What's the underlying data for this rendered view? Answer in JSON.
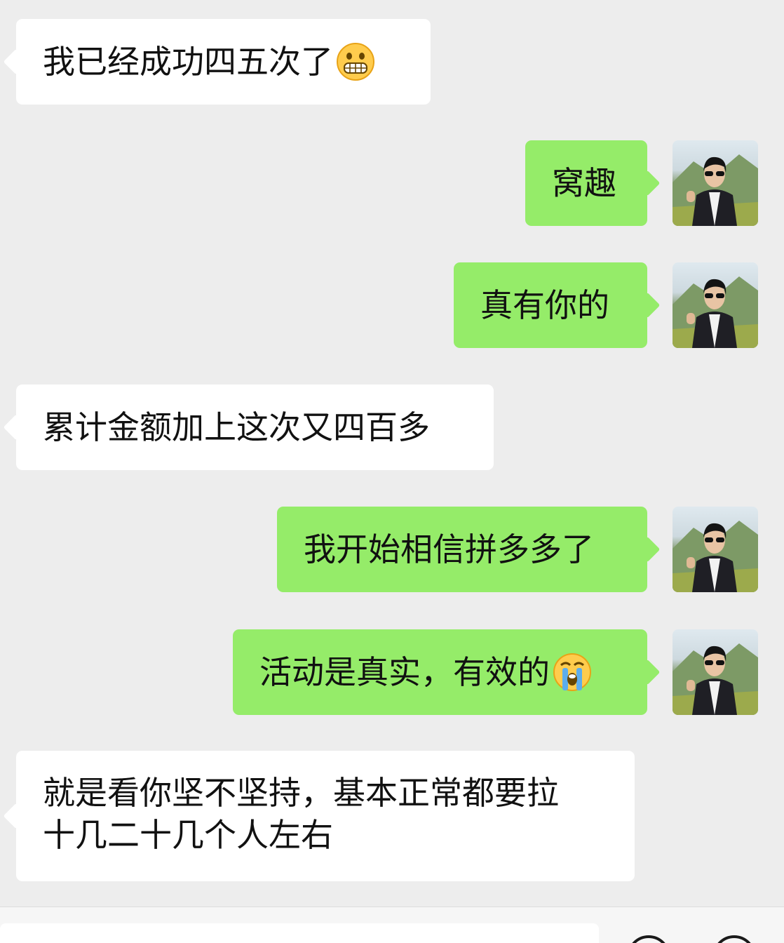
{
  "messages": [
    {
      "side": "in",
      "text": "我已经成功四五次了",
      "emoji": "grin-emoji"
    },
    {
      "side": "out",
      "text": "窝趣"
    },
    {
      "side": "out",
      "text": "真有你的"
    },
    {
      "side": "in",
      "text": "累计金额加上这次又四百多"
    },
    {
      "side": "out",
      "text": "我开始相信拼多多了"
    },
    {
      "side": "out",
      "text": "活动是真实，有效的",
      "emoji": "crying-emoji"
    },
    {
      "side": "in",
      "text_line1": "就是看你坚不坚持，基本正常都要拉",
      "text_line2": "十几二十几个人左右"
    }
  ],
  "colors": {
    "background": "#ededed",
    "incoming_bubble": "#ffffff",
    "outgoing_bubble": "#95ec69",
    "text": "#111111"
  },
  "icons": {
    "avatar": "user-avatar-photo",
    "voice": "voice-icon",
    "emoji_picker": "emoji-icon"
  }
}
